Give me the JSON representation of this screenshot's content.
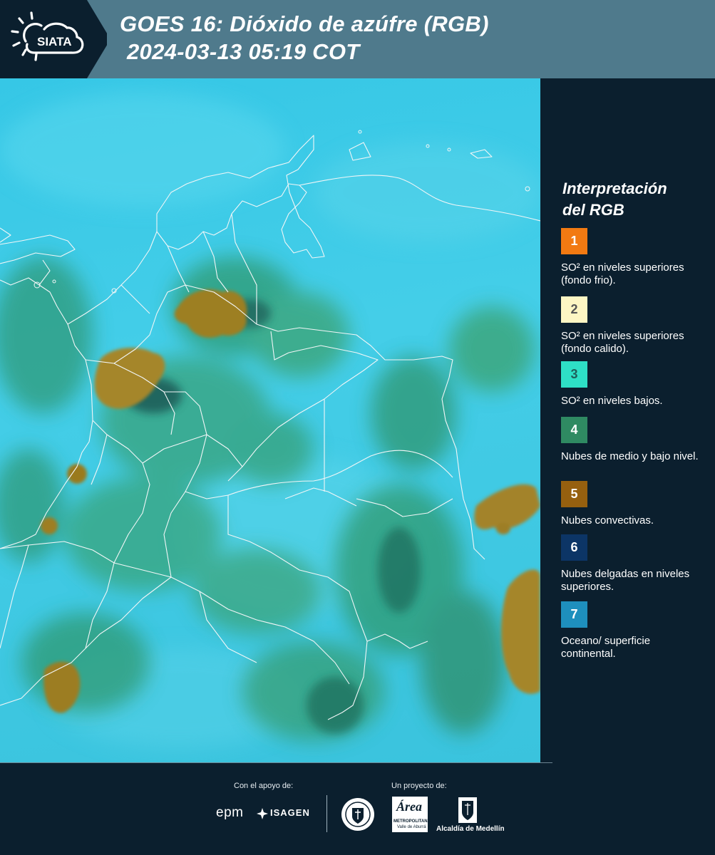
{
  "header": {
    "logo_text": "SIATA",
    "title_line1": "GOES 16: Dióxido de azúfre (RGB)",
    "title_line2": "2024-03-13 05:19 COT"
  },
  "legend": {
    "title_line1": "Interpretación",
    "title_line2": "del RGB",
    "items": [
      {
        "number": "1",
        "label": "SO² en niveles superiores (fondo frio).",
        "color": "#f27a12",
        "text_color": "#ffffff"
      },
      {
        "number": "2",
        "label": "SO² en niveles superiores (fondo calido).",
        "color": "#fdf6c4",
        "text_color": "#555555"
      },
      {
        "number": "3",
        "label": "SO² en niveles bajos.",
        "color": "#2ee0c6",
        "text_color": "#1f5f5a"
      },
      {
        "number": "4",
        "label": "Nubes de medio y bajo nivel.",
        "color": "#2f8a62",
        "text_color": "#ffffff"
      },
      {
        "number": "5",
        "label": "Nubes convectivas.",
        "color": "#96600f",
        "text_color": "#ffffff"
      },
      {
        "number": "6",
        "label": "Nubes delgadas en niveles superiores.",
        "color": "#0c3566",
        "text_color": "#ffffff"
      },
      {
        "number": "7",
        "label": "Oceano/ superficie continental.",
        "color": "#1e8fbd",
        "text_color": "#ffffff"
      }
    ]
  },
  "footer": {
    "support_label": "Con el apoyo de:",
    "project_label": "Un proyecto de:",
    "sponsor_epm": "epm",
    "sponsor_isagen": "ISAGEN",
    "sponsor_metro_title": "Área",
    "sponsor_metro_sub1": "METROPOLITANA",
    "sponsor_metro_sub2": "Valle de Aburrá",
    "sponsor_alcaldia": "Alcaldía de Medellín"
  },
  "colors": {
    "background": "#0b1f2e",
    "header": "#4f7a8c",
    "ocean": "#3ac8e5",
    "low_cloud": "#2f9a6a",
    "convective": "#a2801f",
    "border_line": "#f2f6f7"
  }
}
